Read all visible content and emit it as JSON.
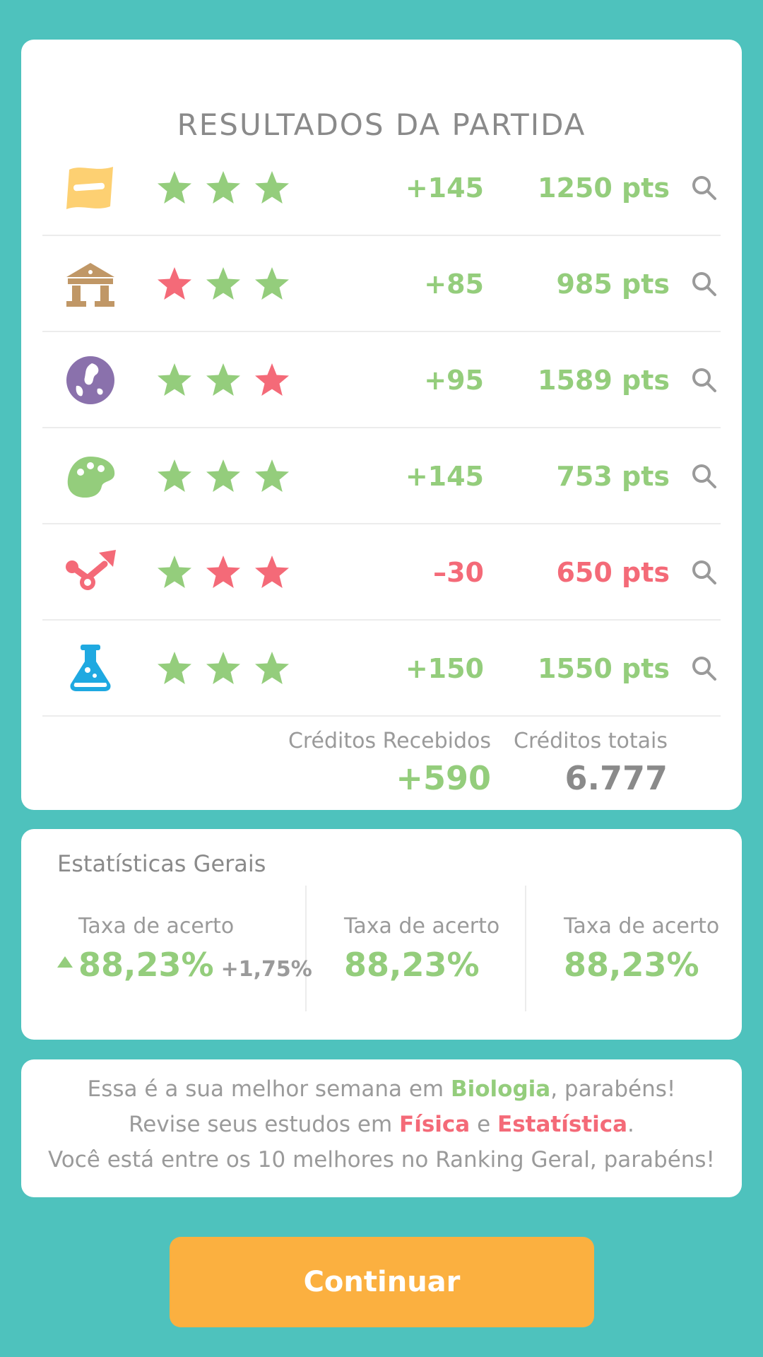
{
  "results": {
    "title": "RESULTADOS DA PARTIDA",
    "rows": [
      {
        "subject_icon": "flag-icon",
        "icon_color": "#fdd072",
        "stars": [
          "green",
          "green",
          "green"
        ],
        "delta": "+145",
        "points": "1250 pts",
        "status": "green"
      },
      {
        "subject_icon": "temple-icon",
        "icon_color": "#c09766",
        "stars": [
          "red",
          "green",
          "green"
        ],
        "delta": "+85",
        "points": "985 pts",
        "status": "green"
      },
      {
        "subject_icon": "globe-icon",
        "icon_color": "#8a71ac",
        "stars": [
          "green",
          "green",
          "red"
        ],
        "delta": "+95",
        "points": "1589 pts",
        "status": "green"
      },
      {
        "subject_icon": "palette-icon",
        "icon_color": "#94cd7c",
        "stars": [
          "green",
          "green",
          "green"
        ],
        "delta": "+145",
        "points": "753 pts",
        "status": "green"
      },
      {
        "subject_icon": "molecule-icon",
        "icon_color": "#f46a78",
        "stars": [
          "green",
          "red",
          "red"
        ],
        "delta": "–30",
        "points": "650 pts",
        "status": "red"
      },
      {
        "subject_icon": "flask-icon",
        "icon_color": "#1fa9e1",
        "stars": [
          "green",
          "green",
          "green"
        ],
        "delta": "+150",
        "points": "1550 pts",
        "status": "green"
      }
    ],
    "credits_received_label": "Créditos Recebidos",
    "credits_received_value": "+590",
    "credits_total_label": "Créditos totais",
    "credits_total_value": "6.777"
  },
  "stats": {
    "title": "Estatísticas Gerais",
    "items": [
      {
        "label": "Taxa de acerto",
        "value": "88,23%",
        "change": "+1,75%",
        "trend": "up"
      },
      {
        "label": "Taxa de acerto",
        "value": "88,23%"
      },
      {
        "label": "Taxa de acerto",
        "value": "88,23%"
      }
    ]
  },
  "message": {
    "line1_pre": "Essa é a sua melhor semana em ",
    "line1_highlight": "Biologia",
    "line1_post": ", parabéns!",
    "line2_pre": "Revise seus estudos em ",
    "line2_highlight1": "Física",
    "line2_mid": " e ",
    "line2_highlight2": "Estatística",
    "line2_post": ".",
    "line3": "Você está entre os 10 melhores no Ranking Geral, parabéns!"
  },
  "continue_label": "Continuar",
  "colors": {
    "background": "#4ec2bd",
    "green": "#94cd7c",
    "red": "#f46a78",
    "button": "#fbb040",
    "gray_text": "#8a8a8a"
  }
}
